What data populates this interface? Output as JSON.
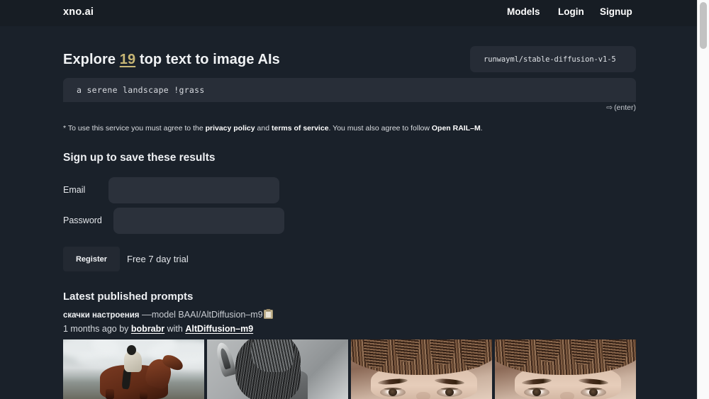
{
  "header": {
    "logo": "xno.ai",
    "nav": [
      {
        "label": "Models"
      },
      {
        "label": "Login"
      },
      {
        "label": "Signup"
      }
    ]
  },
  "hero": {
    "title_prefix": "Explore ",
    "title_count": "19",
    "title_suffix": " top text to image AIs"
  },
  "model_selector": {
    "value": "runwayml/stable-diffusion-v1-5"
  },
  "prompt": {
    "value": "a serene landscape !grass",
    "placeholder": "a serene landscape !grass",
    "enter_hint_arrow": "⇨",
    "enter_hint_label": "(enter)"
  },
  "disclaimer": {
    "part1": "* To use this service you must agree to the ",
    "link_privacy": "privacy policy",
    "part2": " and ",
    "link_terms": "terms of service",
    "part3": ". You must also agree to follow ",
    "link_license": "Open RAIL–M",
    "part4": "."
  },
  "signup": {
    "heading": "Sign up to save these results",
    "email_label": "Email",
    "email_value": "",
    "email_placeholder": "",
    "password_label": "Password",
    "password_value": "",
    "password_placeholder": "",
    "register_label": "Register",
    "trial_note": "Free 7 day trial"
  },
  "latest": {
    "heading": "Latest published prompts",
    "entry": {
      "text": "скачки настроения",
      "model_flag": " ––model BAAI/AltDiffusion–m9",
      "copy_icon": "clipboard-icon",
      "meta_time": "1 months ago by ",
      "meta_author": "bobrabr",
      "meta_with": " with ",
      "meta_model": "AltDiffusion–m9"
    },
    "results": [
      {
        "alt": "rider on brown horse under cloudy sky"
      },
      {
        "alt": "black and white horse mane close-up"
      },
      {
        "alt": "portrait of woman with voluminous hair"
      },
      {
        "alt": "portrait of woman with voluminous hair"
      }
    ]
  },
  "colors": {
    "background": "#1a212a",
    "header": "#171d24",
    "field": "#2b313b",
    "prompt_box": "#282e38",
    "accent_gold": "#c7b675",
    "text": "#e8eaed"
  },
  "scrollbar": {
    "position": "right",
    "thumb_top_pct": 0
  }
}
